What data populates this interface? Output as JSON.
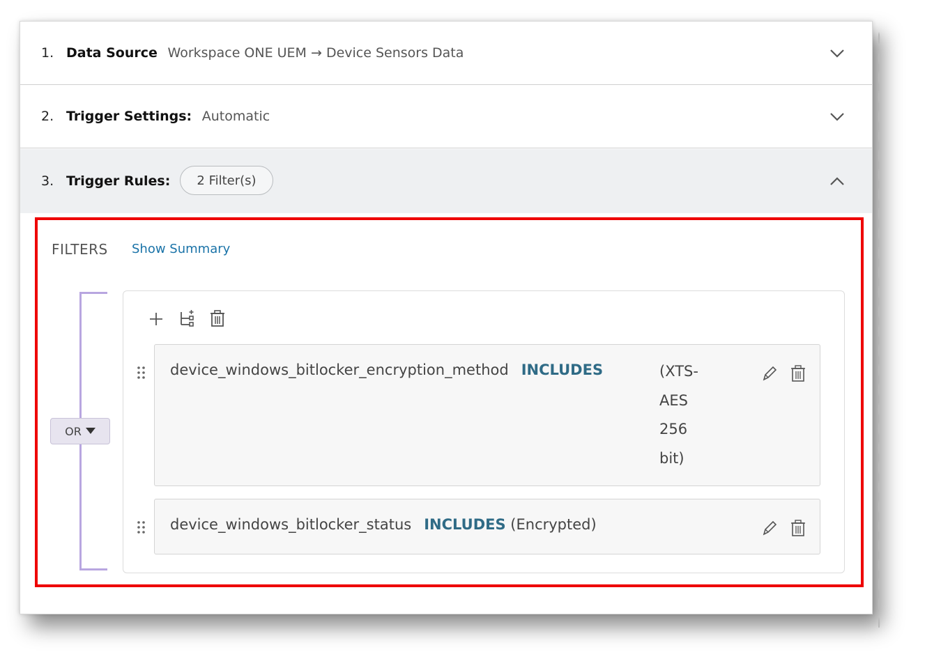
{
  "sections": [
    {
      "number": "1.",
      "label": "Data Source",
      "value": "Workspace ONE UEM → Device Sensors Data"
    },
    {
      "number": "2.",
      "label": "Trigger Settings:",
      "value": "Automatic"
    },
    {
      "number": "3.",
      "label": "Trigger Rules:",
      "badge": "2 Filter(s)"
    }
  ],
  "filters": {
    "title": "FILTERS",
    "show_summary": "Show Summary",
    "operator": "OR",
    "rules": [
      {
        "field": "device_windows_bitlocker_encryption_method",
        "op": "INCLUDES",
        "value_lines": [
          "(XTS-",
          "AES",
          "256",
          "bit)"
        ]
      },
      {
        "field": "device_windows_bitlocker_status",
        "op": "INCLUDES",
        "value": "(Encrypted)"
      }
    ]
  },
  "colors": {
    "highlight": "#ee0000",
    "link": "#1a73a8",
    "operator": "#2f6b86",
    "bracket": "#b8a6e0"
  },
  "icons": [
    "chevron-down-icon",
    "chevron-up-icon",
    "plus-icon",
    "add-group-icon",
    "trash-icon",
    "drag-handle-icon",
    "pencil-icon",
    "caret-down-icon"
  ]
}
